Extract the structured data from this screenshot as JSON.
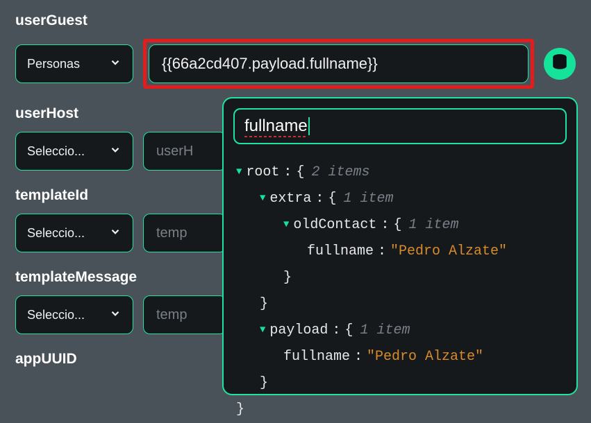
{
  "fields": {
    "userGuest": {
      "label": "userGuest",
      "select": "Personas",
      "input": "{{66a2cd407.payload.fullname}}"
    },
    "userHost": {
      "label": "userHost",
      "select": "Seleccio...",
      "placeholder": "userH"
    },
    "templateId": {
      "label": "templateId",
      "select": "Seleccio...",
      "placeholder": "temp"
    },
    "templateMessage": {
      "label": "templateMessage",
      "select": "Seleccio...",
      "placeholder": "temp"
    },
    "appUUID": {
      "label": "appUUID"
    }
  },
  "popover": {
    "search": "fullname",
    "tree": {
      "root_label": "root",
      "root_meta": "2 items",
      "extra_label": "extra",
      "extra_meta": "1 item",
      "oldContact_label": "oldContact",
      "oldContact_meta": "1 item",
      "fullname1_key": "fullname",
      "fullname1_val": "\"Pedro Alzate\"",
      "payload_label": "payload",
      "payload_meta": "1 item",
      "fullname2_key": "fullname",
      "fullname2_val": "\"Pedro Alzate\"",
      "brace_open": "{",
      "brace_close": "}"
    }
  }
}
